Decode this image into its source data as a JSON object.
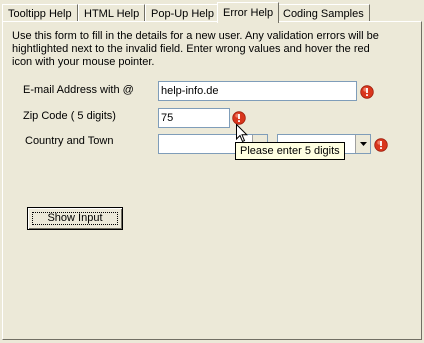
{
  "tabs": [
    {
      "label": "Tooltipp Help"
    },
    {
      "label": "HTML Help"
    },
    {
      "label": "Pop-Up Help"
    },
    {
      "label": "Error Help",
      "active": true
    },
    {
      "label": "Coding Samples"
    }
  ],
  "form": {
    "intro": "Use this form to fill in the details for a new user. Any validation errors will be hightlighted next to the invalid field. Enter wrong values and hover the red icon with your mouse pointer.",
    "email": {
      "label": "E-mail Address with @",
      "value": "help-info.de"
    },
    "zip": {
      "label": "Zip Code ( 5 digits)",
      "value": "75"
    },
    "country_town": {
      "label": "Country and Town",
      "country_value": "",
      "town_value": ""
    },
    "tooltip": "Please enter 5 digits",
    "show_input_button": "Show Input"
  },
  "icons": {
    "error": "error-exclamation-icon",
    "cursor": "mouse-pointer-icon",
    "dropdown": "chevron-down-icon"
  },
  "colors": {
    "window_bg": "#ece9d8",
    "error_red": "#d9361d",
    "tooltip_bg": "#ffffe1",
    "input_border": "#7f9db9"
  }
}
